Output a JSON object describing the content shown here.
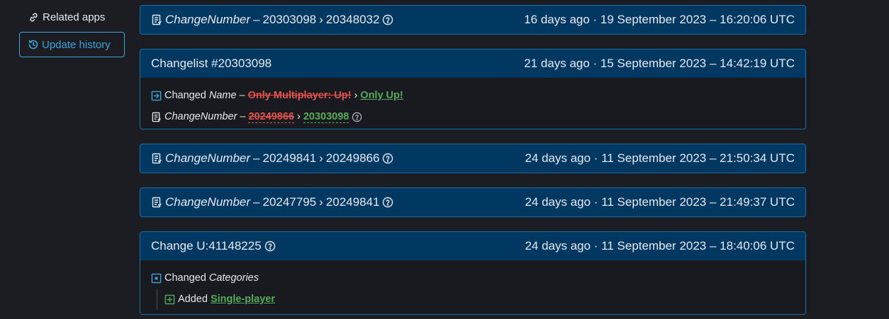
{
  "sidebar": {
    "related_apps": "Related apps",
    "update_history": "Update history"
  },
  "cards": [
    {
      "field": "ChangeNumber",
      "dash": "–",
      "from": "20303098",
      "arrow": "›",
      "to": "20348032",
      "time": "16 days ago · 19 September 2023 – 16:20:06 UTC"
    },
    {
      "title": "Changelist #20303098",
      "time": "21 days ago · 15 September 2023 – 14:42:19 UTC",
      "rows": [
        {
          "verb": "Changed",
          "field": "Name",
          "dash": "–",
          "old": "Only Multiplayer: Up!",
          "arrow": "›",
          "new": "Only Up!"
        },
        {
          "field": "ChangeNumber",
          "dash": "–",
          "old": "20249866",
          "arrow": "›",
          "new": "20303098"
        }
      ]
    },
    {
      "field": "ChangeNumber",
      "dash": "–",
      "from": "20249841",
      "arrow": "›",
      "to": "20249866",
      "time": "24 days ago · 11 September 2023 – 21:50:34 UTC"
    },
    {
      "field": "ChangeNumber",
      "dash": "–",
      "from": "20247795",
      "arrow": "›",
      "to": "20249841",
      "time": "24 days ago · 11 September 2023 – 21:49:37 UTC"
    },
    {
      "title": "Change U:41148225",
      "time": "24 days ago · 11 September 2023 – 18:40:06 UTC",
      "rows": [
        {
          "verb": "Changed",
          "field": "Categories"
        },
        {
          "verb": "Added",
          "value": "Single-player"
        }
      ]
    }
  ],
  "colors": {
    "accent": "#3da3d8",
    "header_bg": "#003862",
    "removed": "#e5534b",
    "added": "#57ab5a"
  }
}
